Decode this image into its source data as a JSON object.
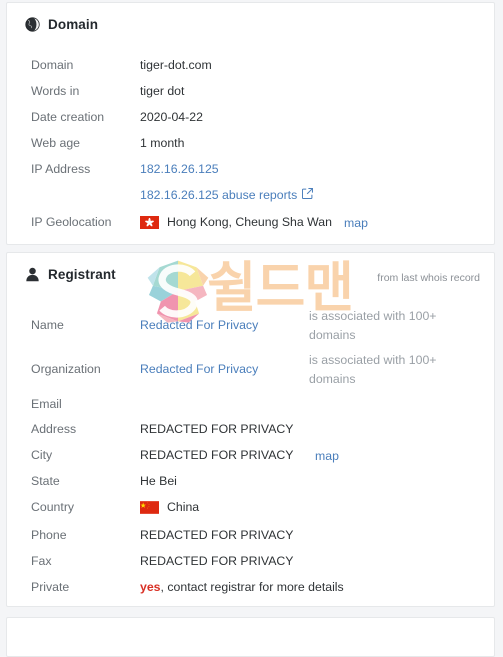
{
  "domain_card": {
    "icon": "globe-icon",
    "title": "Domain",
    "rows": [
      {
        "label": "Domain",
        "value": "tiger-dot.com",
        "type": "text"
      },
      {
        "label": "Words in",
        "value": "tiger dot",
        "type": "text"
      },
      {
        "label": "Date creation",
        "value": "2020-04-22",
        "type": "text"
      },
      {
        "label": "Web age",
        "value": "1 month",
        "type": "text"
      },
      {
        "label": "IP Address",
        "value": "182.16.26.125",
        "type": "link"
      },
      {
        "label": "",
        "value": "182.16.26.125 abuse reports",
        "type": "link-external"
      },
      {
        "label": "IP Geolocation",
        "value": "Hong Kong, Cheung Sha Wan",
        "type": "flag",
        "flag": "hong-kong-flag",
        "map_label": "map"
      }
    ]
  },
  "registrant_card": {
    "icon": "user-icon",
    "title": "Registrant",
    "note": "from last whois record",
    "assoc_name": "is associated with 100+ domains",
    "assoc_org": "is associated with 100+ domains",
    "rows": [
      {
        "label": "Name",
        "value": "Redacted For Privacy",
        "type": "link"
      },
      {
        "label": "Organization",
        "value": "Redacted For Privacy",
        "type": "link"
      },
      {
        "label": "Email",
        "value": "",
        "type": "text"
      },
      {
        "label": "Address",
        "value": "REDACTED FOR PRIVACY",
        "type": "text"
      },
      {
        "label": "City",
        "value": "REDACTED FOR PRIVACY",
        "type": "text",
        "map_label": "map"
      },
      {
        "label": "State",
        "value": "He Bei",
        "type": "text"
      },
      {
        "label": "Country",
        "value": "China",
        "type": "flag",
        "flag": "china-flag"
      },
      {
        "label": "Phone",
        "value": "REDACTED FOR PRIVACY",
        "type": "text"
      },
      {
        "label": "Fax",
        "value": "REDACTED FOR PRIVACY",
        "type": "text"
      },
      {
        "label": "Private",
        "value_strong": "yes",
        "value": ", contact registrar for more details",
        "type": "private"
      }
    ]
  },
  "watermark": {
    "logo_letter": "S",
    "text": "쉴드맨",
    "colors": {
      "orange": "#f6b97a",
      "pink": "#e8537f",
      "teal": "#5bb8c4",
      "yellow": "#f2d95c"
    }
  },
  "colors": {
    "link": "#4a7ebb",
    "label": "#6a7076",
    "value": "#2f3336",
    "muted": "#9aa0a6",
    "danger": "#d93025",
    "card_border": "#e6e8ea",
    "page_bg": "#f4f5f7"
  }
}
